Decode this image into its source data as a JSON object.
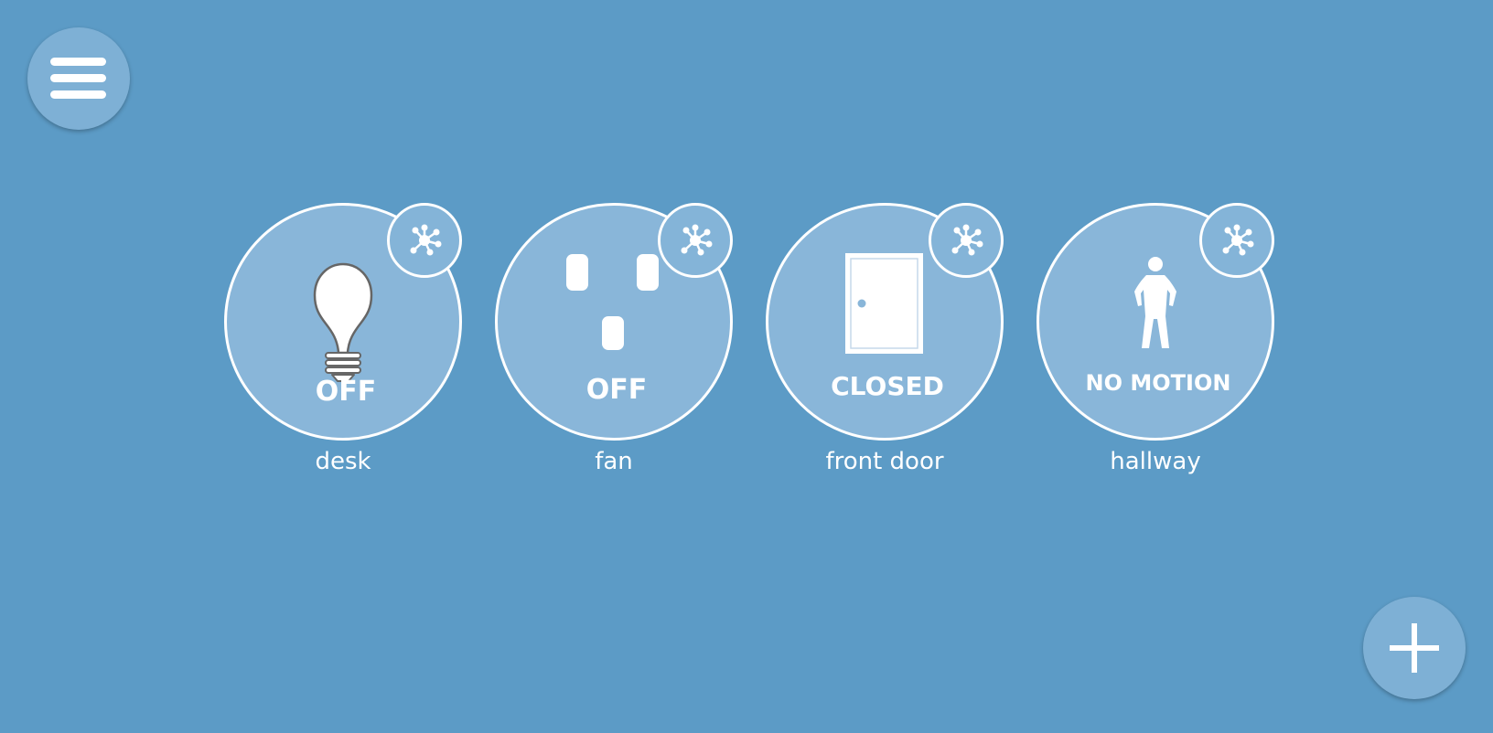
{
  "header": {
    "menu_icon": "hamburger-menu-icon"
  },
  "footer": {
    "add_icon": "plus-icon"
  },
  "hub_icon": "network-hub-icon",
  "devices": [
    {
      "icon": "lightbulb-icon",
      "state": "OFF",
      "label": "desk"
    },
    {
      "icon": "outlet-icon",
      "state": "OFF",
      "label": "fan"
    },
    {
      "icon": "door-icon",
      "state": "CLOSED",
      "label": "front door"
    },
    {
      "icon": "person-icon",
      "state": "NO MOTION",
      "label": "hallway"
    }
  ],
  "colors": {
    "background": "#5c9bc6",
    "tile": "#89b6d9",
    "floating_button": "#7eb0d5",
    "foreground": "#ffffff"
  }
}
